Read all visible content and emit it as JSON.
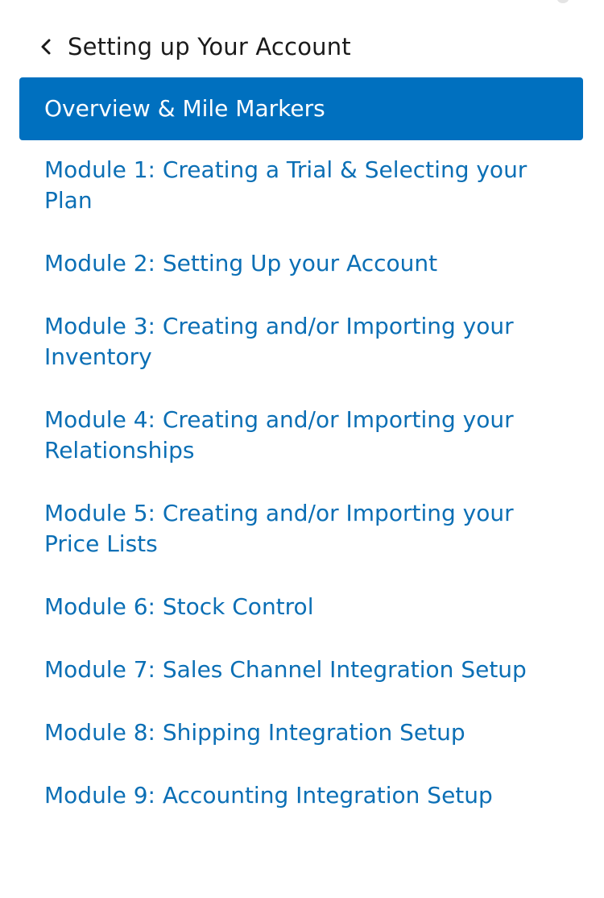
{
  "header": {
    "back_icon": "chevron-left-icon",
    "title": "Setting up Your Account"
  },
  "colors": {
    "accent": "#0070bf",
    "link": "#0b6fb5",
    "active_text": "#ffffff",
    "title_text": "#1a1a1a"
  },
  "nav": {
    "items": [
      {
        "label": "Overview & Mile Markers",
        "active": true
      },
      {
        "label": "Module 1: Creating a Trial & Selecting your Plan"
      },
      {
        "label": "Module 2: Setting Up your Account"
      },
      {
        "label": "Module 3: Creating and/or Importing your Inventory"
      },
      {
        "label": "Module 4: Creating and/or Importing your Relationships"
      },
      {
        "label": "Module 5: Creating and/or Importing your Price Lists"
      },
      {
        "label": "Module 6: Stock Control"
      },
      {
        "label": "Module 7: Sales Channel Integration Setup"
      },
      {
        "label": "Module 8: Shipping Integration Setup"
      },
      {
        "label": "Module 9: Accounting Integration Setup"
      }
    ]
  }
}
